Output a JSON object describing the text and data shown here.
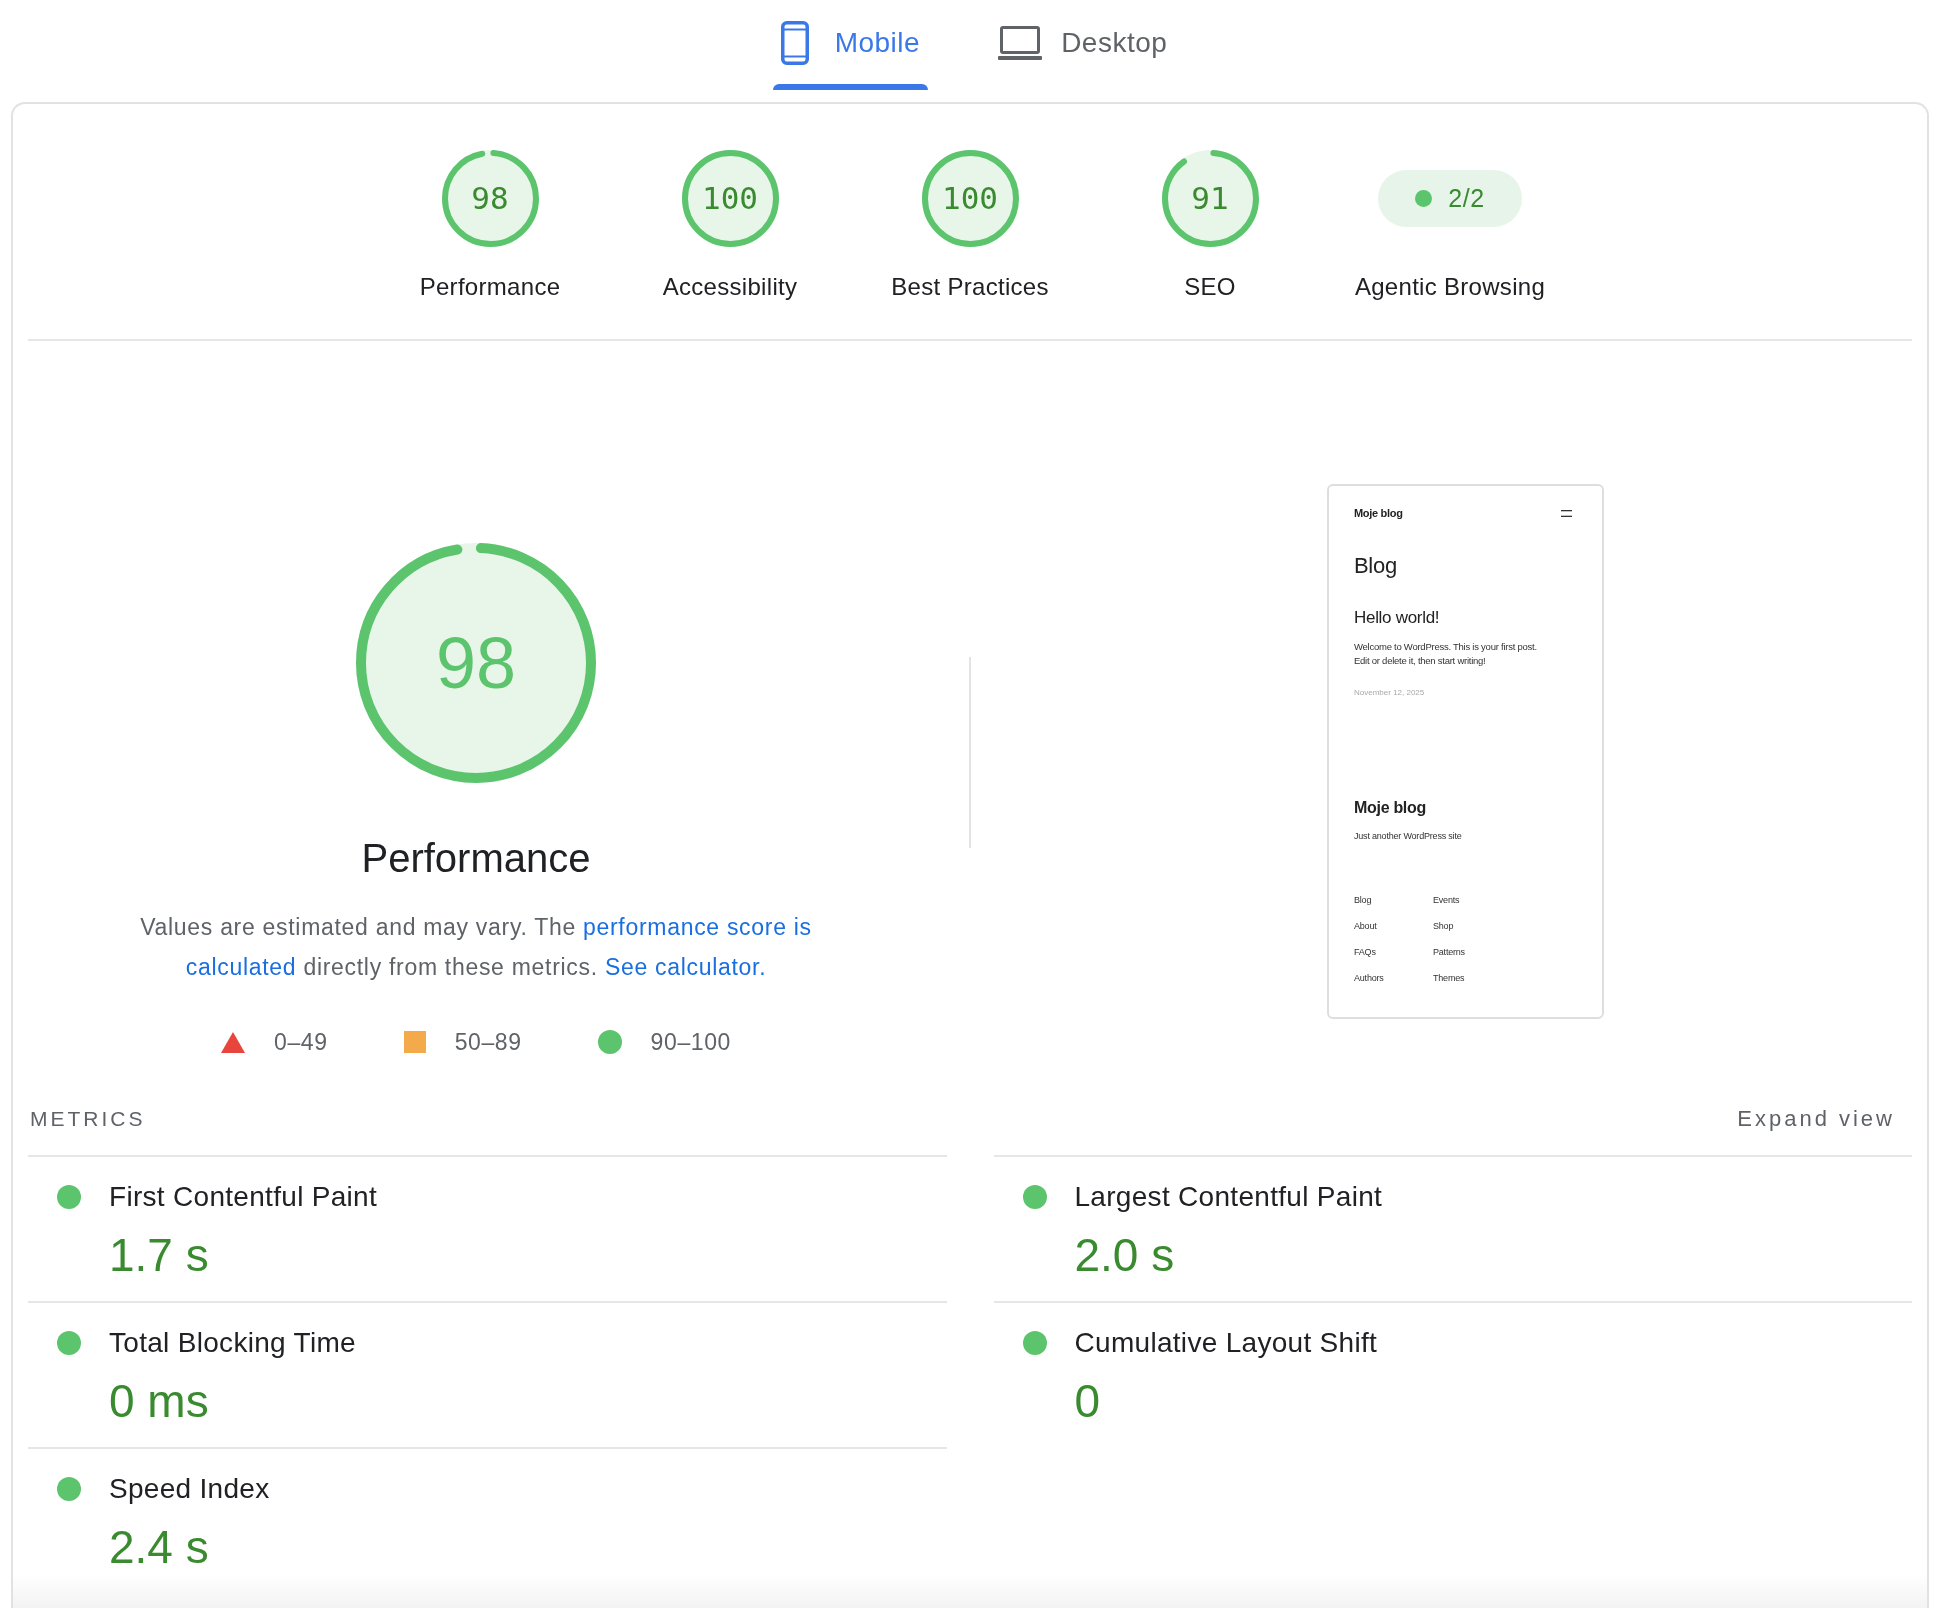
{
  "tabs": [
    {
      "label": "Mobile",
      "kind": "mobile",
      "selected": true
    },
    {
      "label": "Desktop",
      "kind": "desktop",
      "selected": false
    }
  ],
  "categories": [
    {
      "kind": "gauge",
      "score": "98",
      "label": "Performance"
    },
    {
      "kind": "gauge",
      "score": "100",
      "label": "Accessibility"
    },
    {
      "kind": "gauge",
      "score": "100",
      "label": "Best Practices"
    },
    {
      "kind": "gauge",
      "score": "91",
      "label": "SEO"
    },
    {
      "kind": "badge",
      "score": "2/2",
      "label": "Agentic Browsing"
    }
  ],
  "performance": {
    "score": "98",
    "title": "Performance",
    "description": [
      {
        "kind": "text",
        "text": "Values are estimated and may vary. The "
      },
      {
        "kind": "link",
        "text": "performance score is"
      },
      {
        "kind": "link",
        "text": "calculated"
      },
      {
        "kind": "text",
        "text": " directly from these metrics. "
      },
      {
        "kind": "link",
        "text": "See calculator."
      }
    ],
    "legend": [
      {
        "kind": "triangle",
        "color": "#e8453c",
        "label": "0–49"
      },
      {
        "kind": "square",
        "color": "#f4a94a",
        "label": "50–89"
      },
      {
        "kind": "circle",
        "color": "#5cc46d",
        "label": "90–100"
      }
    ]
  },
  "page_screenshot": {
    "site_title": "Moje blog",
    "heading": "Blog",
    "post_title": "Hello world!",
    "post_excerpt": "Welcome to WordPress. This is your first post. Edit or delete it, then start writing!",
    "post_date": "November 12, 2025",
    "footer_title": "Moje blog",
    "footer_tagline": "Just another WordPress site",
    "footer_link_columns": [
      {
        "links": [
          "Blog",
          "About",
          "FAQs",
          "Authors"
        ]
      },
      {
        "links": [
          "Events",
          "Shop",
          "Patterns",
          "Themes"
        ]
      }
    ]
  },
  "metrics": {
    "heading": "METRICS",
    "expand_button": "Expand view",
    "items": [
      {
        "title": "First Contentful Paint",
        "value": "1.7 s",
        "color": "#5cc46d"
      },
      {
        "title": "Largest Contentful Paint",
        "value": "2.0 s",
        "color": "#5cc46d"
      },
      {
        "title": "Total Blocking Time",
        "value": "0 ms",
        "color": "#5cc46d"
      },
      {
        "title": "Cumulative Layout Shift",
        "value": "0",
        "color": "#5cc46d"
      },
      {
        "title": "Speed Index",
        "value": "2.4 s",
        "color": "#5cc46d"
      }
    ]
  }
}
